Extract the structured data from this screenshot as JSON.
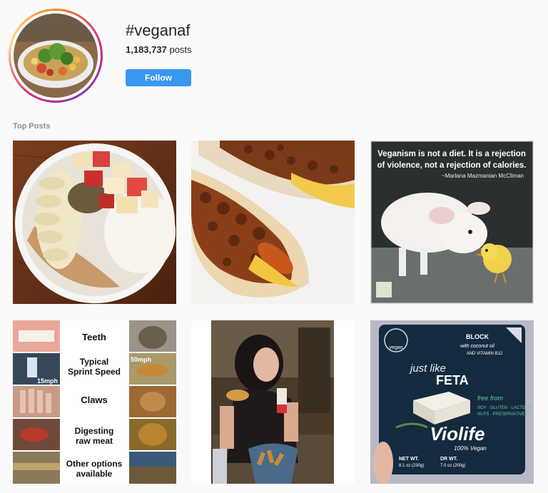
{
  "header": {
    "hashtag": "#veganaf",
    "post_count": "1,183,737",
    "posts_label": "posts",
    "follow_label": "Follow"
  },
  "section": {
    "top_posts_label": "Top Posts"
  },
  "posts": [
    {
      "icon": "food-bowl-photo"
    },
    {
      "icon": "hotdog-photo"
    },
    {
      "icon": "lamb-chick-photo",
      "quote_line1": "Veganism is not a diet. It is a rejection",
      "quote_line2": "of violence, not a rejection of calories.",
      "attribution": "~Marlana Mazmanian McCliman"
    },
    {
      "icon": "comparison-collage",
      "labels": [
        "Teeth",
        "Typical",
        "Sprint Speed",
        "Claws",
        "Digesting",
        "raw meat",
        "Other options",
        "available"
      ],
      "human_speed": "15mph",
      "lion_speed": "50mph"
    },
    {
      "icon": "woman-eating-photo"
    },
    {
      "icon": "feta-package-photo",
      "brand_badge": "vegan",
      "block": "BLOCK",
      "with_coconut": "with coconut oil",
      "vitamin": "AND VITAMIN B12",
      "just_like": "just like",
      "feta": "FETA",
      "free_from": "free from",
      "allergens": "SOY · GLUTEN · LACTOSE",
      "allergens2": "NUTS · PRESERVATIVES",
      "violife": "Violife",
      "vegan100": "100% Vegan",
      "net_wt": "NET WT.",
      "net_wt_val": "8.1 oz (230g)",
      "dr_wt": "DR WT.",
      "dr_wt_val": "7.0 oz (200g)"
    }
  ],
  "colors": {
    "follow_button": "#3897f0",
    "background": "#fafafa",
    "muted_text": "#8e8e8e"
  }
}
